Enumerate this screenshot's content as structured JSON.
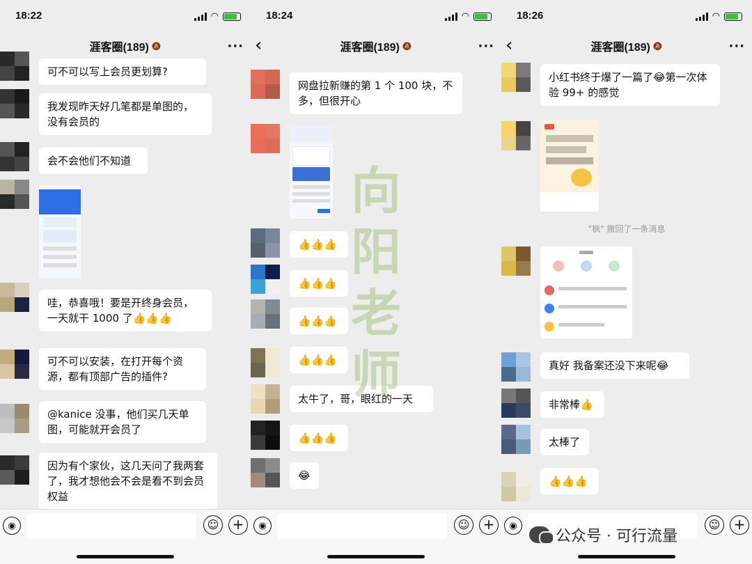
{
  "panels": [
    {
      "time": "18:22",
      "title": "涯客圈(189)",
      "messages": [
        {
          "text": "可不可以写上会员更划算?"
        },
        {
          "text": "我发现昨天好几笔都是单图的，没有会员的"
        },
        {
          "text": "会不会他们不知道"
        },
        {
          "text": "哇，恭喜哦！要是开终身会员，一天就干 1000 了👍👍👍"
        },
        {
          "text": "可不可以安装，在打开每个资源，都有顶部广告的插件?"
        },
        {
          "text": "@kanice 没事，他们买几天单图，可能就开会员了"
        },
        {
          "text": "因为有个家伙，这几天问了我两套了，我才想他会不会是看不到会员权益"
        }
      ]
    },
    {
      "time": "18:24",
      "title": "涯客圈(189)",
      "messages": [
        {
          "text": "网盘拉新赚的第 1 个 100 块，不多，但很开心"
        },
        {
          "text": "👍👍👍"
        },
        {
          "text": "👍👍👍"
        },
        {
          "text": "👍👍👍"
        },
        {
          "text": "👍👍👍"
        },
        {
          "text": "太牛了，哥，眼红的一天"
        },
        {
          "text": "👍👍👍"
        },
        {
          "text": "😂"
        }
      ]
    },
    {
      "time": "18:26",
      "title": "涯客圈(189)",
      "messages": [
        {
          "text": "小红书终于爆了一篇了😂第一次体验 99+ 的感觉"
        },
        {
          "text": "真好 我备案还没下来呢😂"
        },
        {
          "text": "非常棒👍"
        },
        {
          "text": "太棒了"
        },
        {
          "text": "👍👍👍"
        }
      ],
      "recall": "\"枫\" 撤回了一条消息"
    }
  ],
  "watermark": "向阳老师",
  "brand": "公众号 · 可行流量",
  "colors": {
    "background": "#ededed",
    "bubble": "#ffffff",
    "accent": "#36c23b"
  },
  "icons": [
    "back-arrow-icon",
    "more-icon",
    "mute-icon",
    "voice-icon",
    "emoji-icon",
    "plus-icon",
    "wechat-logo-icon"
  ]
}
